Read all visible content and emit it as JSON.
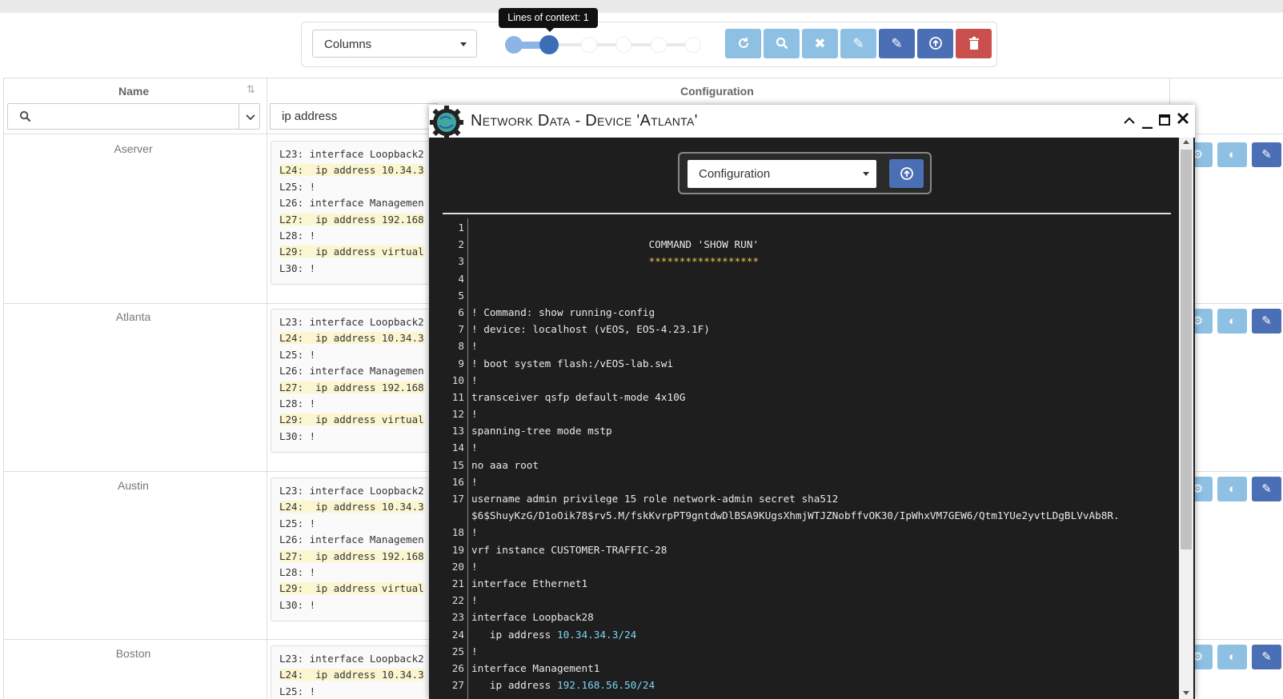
{
  "toolbar": {
    "columns_label": "Columns",
    "tooltip": "Lines of context: 1",
    "context_value": 1,
    "context_max": 5,
    "buttons": [
      "refresh",
      "search",
      "clear",
      "edit",
      "bulk-edit",
      "export",
      "delete"
    ]
  },
  "table": {
    "col_name": "Name",
    "col_config": "Configuration",
    "config_filter": "ip address",
    "rows": [
      {
        "name": "Aserver",
        "lines": [
          "L23: interface Loopback2",
          "L24:  ip address 10.34.3",
          "L25: !",
          "L26: interface Managemen",
          "L27:  ip address 192.168",
          "L28: !",
          "L29:  ip address virtual",
          "L30: !"
        ]
      },
      {
        "name": "Atlanta",
        "lines": [
          "L23: interface Loopback2",
          "L24:  ip address 10.34.3",
          "L25: !",
          "L26: interface Managemen",
          "L27:  ip address 192.168",
          "L28: !",
          "L29:  ip address virtual",
          "L30: !"
        ]
      },
      {
        "name": "Austin",
        "lines": [
          "L23: interface Loopback2",
          "L24:  ip address 10.34.3",
          "L25: !",
          "L26: interface Managemen",
          "L27:  ip address 192.168",
          "L28: !",
          "L29:  ip address virtual",
          "L30: !"
        ]
      },
      {
        "name": "Boston",
        "lines": [
          "L23: interface Loopback2",
          "L24:  ip address 10.34.3",
          "L25: !"
        ]
      }
    ]
  },
  "modal": {
    "title": "Network Data - Device 'Atlanta'",
    "select_value": "Configuration",
    "code": [
      {
        "n": "1",
        "t": ""
      },
      {
        "n": "2",
        "t": "                             COMMAND 'SHOW RUN'"
      },
      {
        "n": "3",
        "t": "                             ******************"
      },
      {
        "n": "4",
        "t": ""
      },
      {
        "n": "5",
        "t": ""
      },
      {
        "n": "6",
        "t": "! Command: show running-config"
      },
      {
        "n": "7",
        "t": "! device: localhost (vEOS, EOS-4.23.1F)"
      },
      {
        "n": "8",
        "t": "!"
      },
      {
        "n": "9",
        "t": "! boot system flash:/vEOS-lab.swi"
      },
      {
        "n": "10",
        "t": "!"
      },
      {
        "n": "11",
        "t": "transceiver qsfp default-mode 4x10G"
      },
      {
        "n": "12",
        "t": "!"
      },
      {
        "n": "13",
        "t": "spanning-tree mode mstp"
      },
      {
        "n": "14",
        "t": "!"
      },
      {
        "n": "15",
        "t": "no aaa root"
      },
      {
        "n": "16",
        "t": "!"
      },
      {
        "n": "17",
        "t": "username admin privilege 15 role network-admin secret sha512"
      },
      {
        "n": "",
        "t": "$6$ShuyKzG/D1oOik78$rv5.M/fskKvrpPT9gntdwDlBSA9KUgsXhmjWTJZNobffvOK30/IpWhxVM7GEW6/Qtm1YUe2yvtLDgBLVvAb8R."
      },
      {
        "n": "18",
        "t": "!"
      },
      {
        "n": "19",
        "t": "vrf instance CUSTOMER-TRAFFIC-28"
      },
      {
        "n": "20",
        "t": "!"
      },
      {
        "n": "21",
        "t": "interface Ethernet1"
      },
      {
        "n": "22",
        "t": "!"
      },
      {
        "n": "23",
        "t": "interface Loopback28"
      },
      {
        "n": "24",
        "t": "   ip address ",
        "ip": "10.34.34.3/24"
      },
      {
        "n": "25",
        "t": "!"
      },
      {
        "n": "26",
        "t": "interface Management1"
      },
      {
        "n": "27",
        "t": "   ip address ",
        "ip": "192.168.56.50/24"
      }
    ]
  }
}
